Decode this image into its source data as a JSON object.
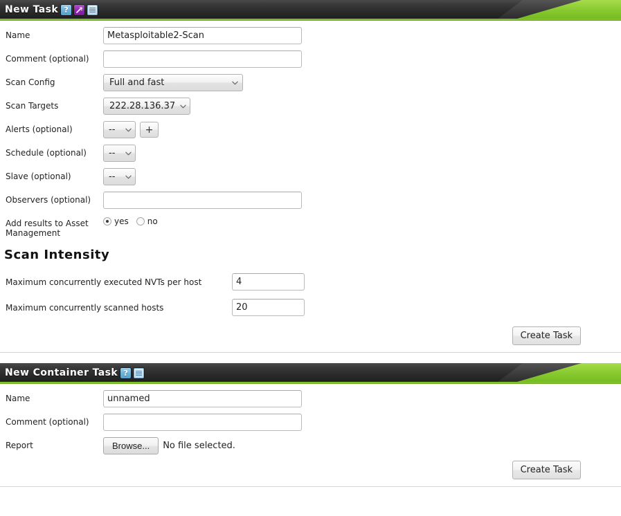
{
  "new_task_panel": {
    "title": "New Task",
    "icons": [
      {
        "name": "help-icon",
        "glyph": "?"
      },
      {
        "name": "wizard-icon",
        "glyph": "wand"
      },
      {
        "name": "list-icon",
        "glyph": "list"
      }
    ],
    "fields": {
      "name_label": "Name",
      "name_value": "Metasploitable2-Scan",
      "comment_label": "Comment (optional)",
      "comment_value": "",
      "scan_config_label": "Scan Config",
      "scan_config_value": "Full and fast",
      "scan_targets_label": "Scan Targets",
      "scan_targets_value": "222.28.136.37",
      "alerts_label": "Alerts (optional)",
      "alerts_value": "--",
      "alerts_add_label": "+",
      "schedule_label": "Schedule (optional)",
      "schedule_value": "--",
      "slave_label": "Slave (optional)",
      "slave_value": "--",
      "observers_label": "Observers (optional)",
      "observers_value": "",
      "asset_label": "Add results to Asset Management",
      "asset_yes_label": "yes",
      "asset_no_label": "no",
      "asset_selected": "yes"
    },
    "scan_intensity": {
      "heading": "Scan Intensity",
      "max_nvts_label": "Maximum concurrently executed NVTs per host",
      "max_nvts_value": "4",
      "max_hosts_label": "Maximum concurrently scanned hosts",
      "max_hosts_value": "20"
    },
    "submit_label": "Create Task"
  },
  "new_container_task_panel": {
    "title": "New Container Task",
    "icons": [
      {
        "name": "help-icon",
        "glyph": "?"
      },
      {
        "name": "list-icon",
        "glyph": "list"
      }
    ],
    "fields": {
      "name_label": "Name",
      "name_value": "unnamed",
      "comment_label": "Comment (optional)",
      "comment_value": "",
      "report_label": "Report",
      "browse_label": "Browse...",
      "file_status": "No file selected."
    },
    "submit_label": "Create Task"
  },
  "colors": {
    "accent_green": "#8dcc33",
    "header_dark": "#2b2b2b",
    "help_blue": "#6cb0d8",
    "wizard_purple": "#9125b4"
  }
}
